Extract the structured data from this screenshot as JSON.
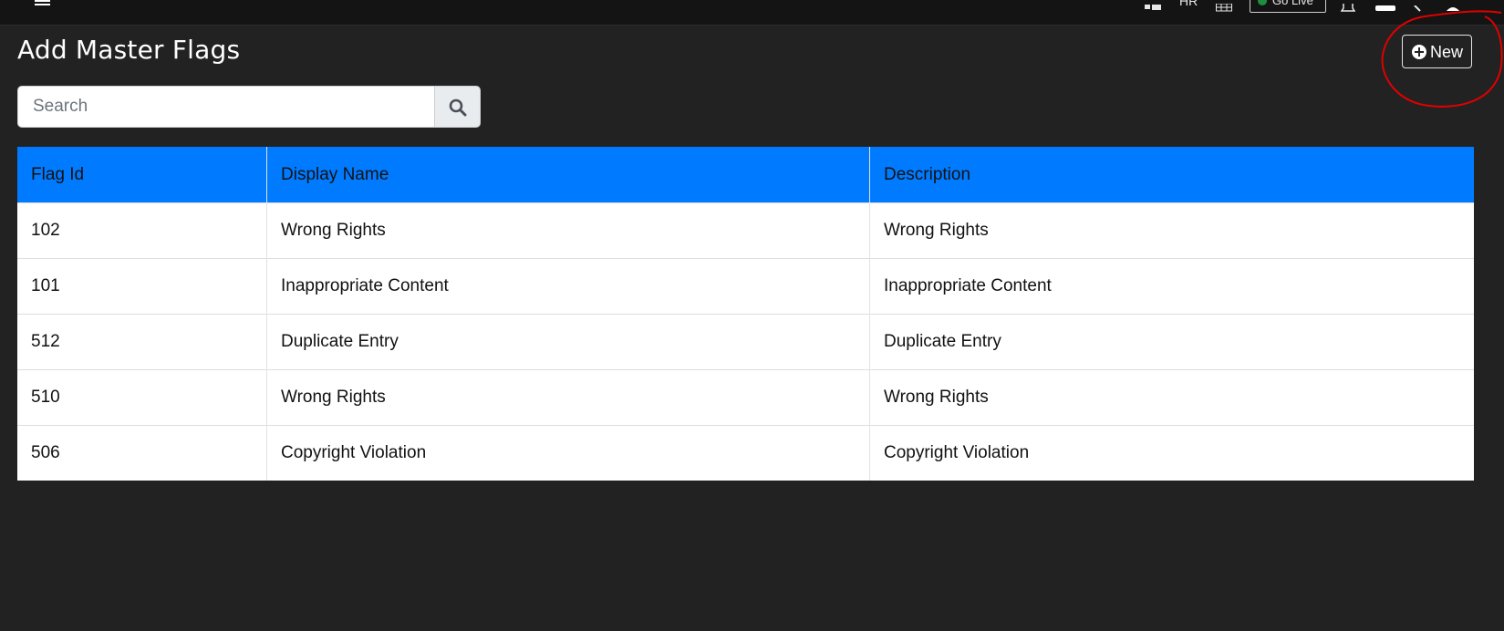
{
  "topbar": {
    "right_label": "HR",
    "status_label": "Go Live",
    "status_color": "#1e8e3e"
  },
  "page": {
    "title": "Add Master Flags",
    "new_button_label": "New"
  },
  "search": {
    "placeholder": "Search"
  },
  "table": {
    "headers": [
      "Flag Id",
      "Display Name",
      "Description"
    ],
    "header_color": "#007bff",
    "rows": [
      [
        "102",
        "Wrong Rights",
        "Wrong Rights"
      ],
      [
        "101",
        "Inappropriate Content",
        "Inappropriate Content"
      ],
      [
        "512",
        "Duplicate Entry",
        "Duplicate Entry"
      ],
      [
        "510",
        "Wrong Rights",
        "Wrong Rights"
      ],
      [
        "506",
        "Copyright Violation",
        "Copyright Violation"
      ]
    ]
  },
  "annotation": {
    "color": "#e00000"
  }
}
